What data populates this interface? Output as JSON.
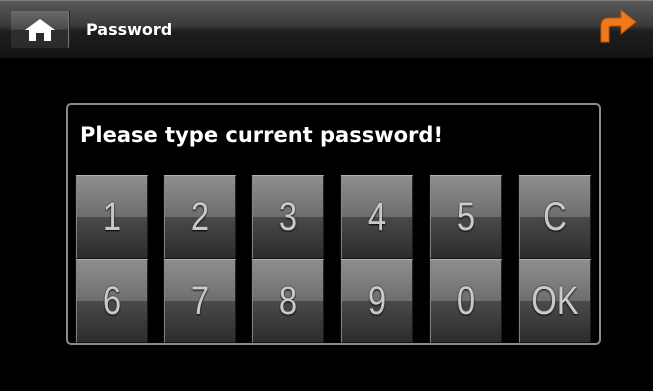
{
  "header": {
    "title": "Password",
    "home_icon": "home-icon",
    "back_icon": "return-arrow-icon",
    "accent_color": "#f07a1a"
  },
  "dialog": {
    "prompt": "Please type current password!"
  },
  "keypad": {
    "row1": [
      "1",
      "2",
      "3",
      "4",
      "5",
      "C"
    ],
    "row2": [
      "6",
      "7",
      "8",
      "9",
      "0",
      "OK"
    ]
  }
}
